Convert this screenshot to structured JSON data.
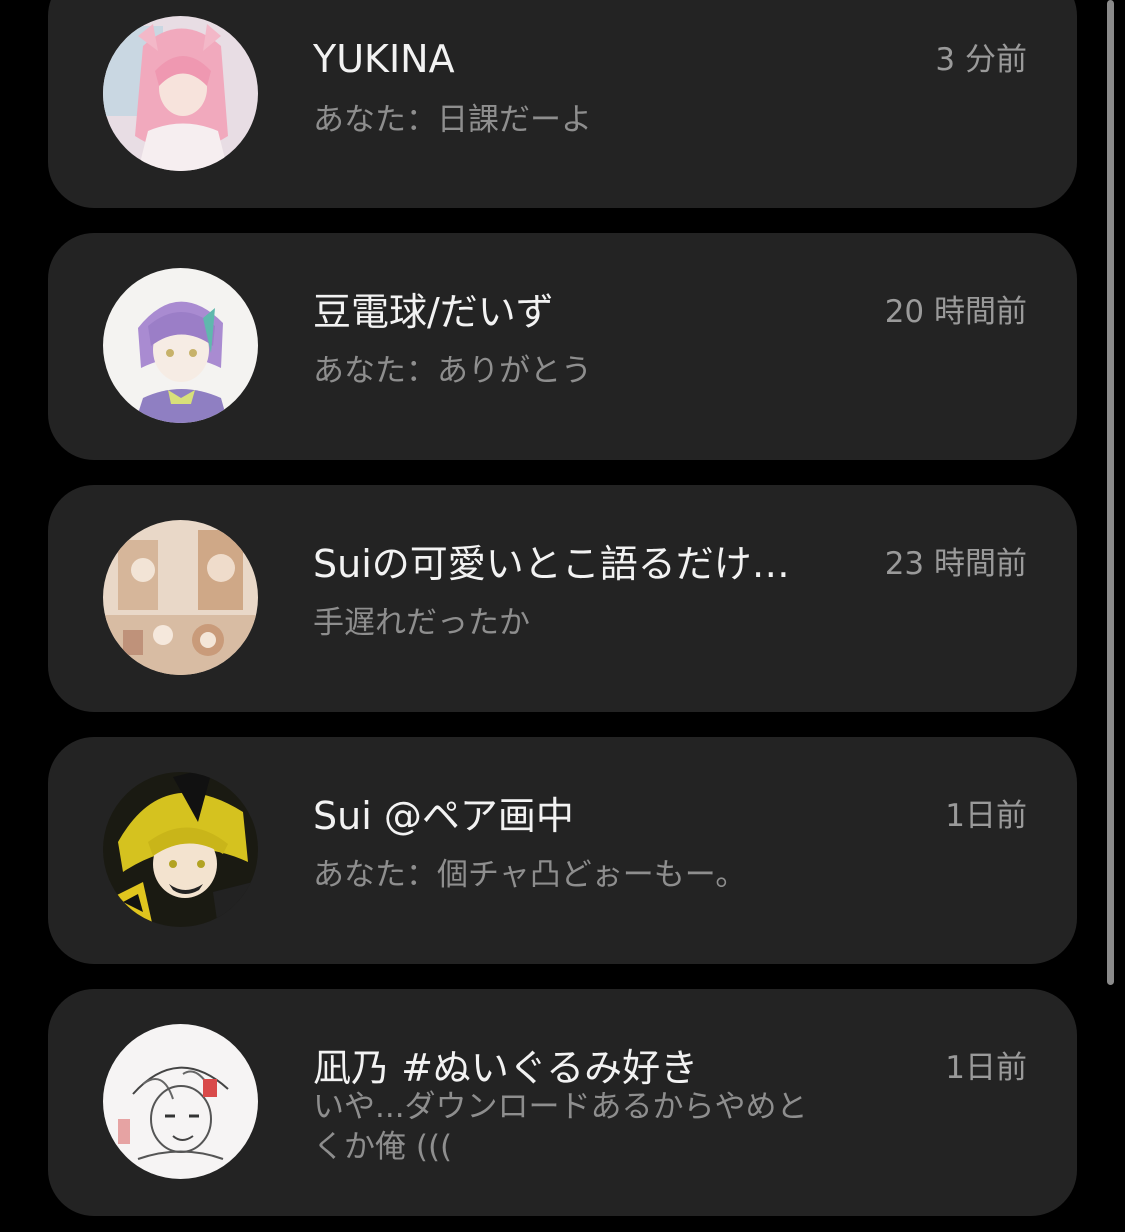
{
  "conversations": [
    {
      "name": "YUKINA",
      "time": "3 分前",
      "preview": "あなた：日課だーよ",
      "avatar_icon": "avatar-pink-hair-icon"
    },
    {
      "name": "豆電球/だいず",
      "time": "20 時間前",
      "preview": "あなた：ありがとう",
      "avatar_icon": "avatar-purple-hair-icon"
    },
    {
      "name": "Suiの可愛いとこ語るだけ…",
      "time": "23 時間前",
      "preview": "手遅れだったか",
      "avatar_icon": "avatar-room-scene-icon"
    },
    {
      "name": "Sui @ペア画中",
      "time": "1日前",
      "preview": "あなた：個チャ凸どぉーもー。",
      "avatar_icon": "avatar-yellow-hair-icon"
    },
    {
      "name": "凪乃 #ぬいぐるみ好き",
      "time": "1日前",
      "preview": "いや...ダウンロードあるからやめとくか俺 (((",
      "avatar_icon": "avatar-sketch-icon"
    }
  ],
  "colors": {
    "background": "#000000",
    "card": "#232323",
    "name_text": "#f2f2f2",
    "secondary_text": "#8e8e8e",
    "scrollbar": "#8a8a8a"
  }
}
